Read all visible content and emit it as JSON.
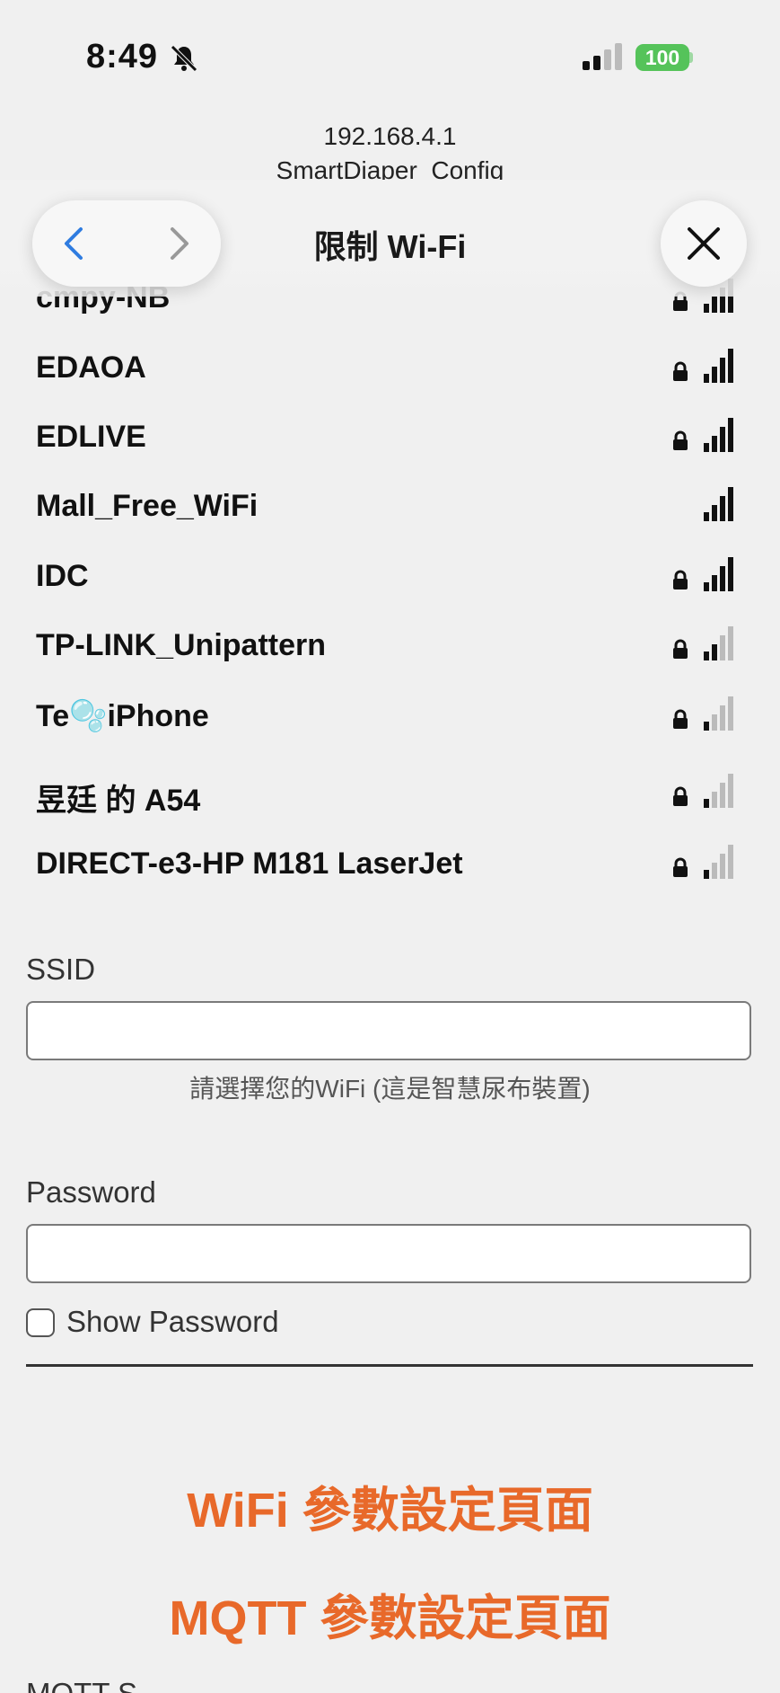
{
  "status_bar": {
    "time": "8:49",
    "battery": "100",
    "battery_color": "#55c35a"
  },
  "browser": {
    "url_line1": "192.168.4.1",
    "url_line2": "SmartDiaper_Config",
    "title": "限制 Wi-Fi"
  },
  "wifi_networks": [
    {
      "name": "cmpy-NB",
      "locked": true,
      "strength": 4
    },
    {
      "name": "EDAOA",
      "locked": true,
      "strength": 4
    },
    {
      "name": "EDLIVE",
      "locked": true,
      "strength": 4
    },
    {
      "name": "Mall_Free_WiFi",
      "locked": false,
      "strength": 4
    },
    {
      "name": "IDC",
      "locked": true,
      "strength": 4
    },
    {
      "name": "TP-LINK_Unipattern",
      "locked": true,
      "strength": 2
    },
    {
      "name": "Te🫧iPhone",
      "locked": true,
      "strength": 1
    },
    {
      "name": "昱廷 的 A54",
      "locked": true,
      "strength": 1
    },
    {
      "name": "DIRECT-e3-HP M181 LaserJet",
      "locked": true,
      "strength": 1
    }
  ],
  "form": {
    "ssid_label": "SSID",
    "ssid_value": "",
    "ssid_hint": "請選擇您的WiFi (這是智慧尿布裝置)",
    "password_label": "Password",
    "password_value": "",
    "show_password_label": "Show Password"
  },
  "links": {
    "wifi_settings": "WiFi 參數設定頁面",
    "mqtt_settings": "MQTT 參數設定頁面"
  },
  "accent_color": "#e8692a",
  "cut_off_label": "MQTT S"
}
